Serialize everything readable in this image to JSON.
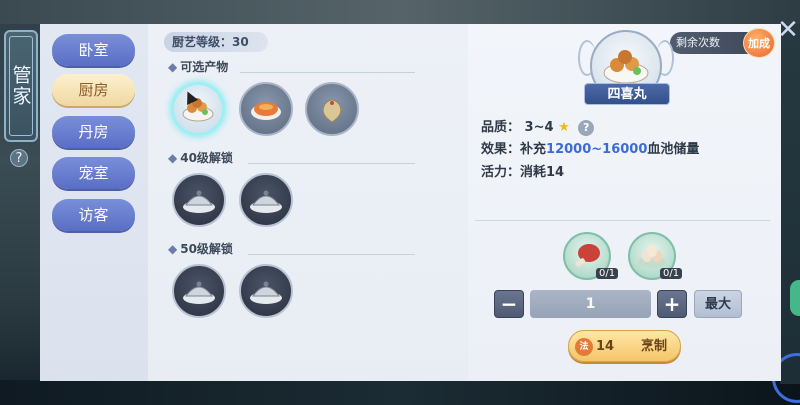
{
  "sidebar": {
    "title": "管家",
    "help": "?"
  },
  "nav": {
    "items": [
      {
        "label": "卧室"
      },
      {
        "label": "厨房"
      },
      {
        "label": "丹房"
      },
      {
        "label": "宠室"
      },
      {
        "label": "访客"
      }
    ]
  },
  "kitchen": {
    "skill_level": "厨艺等级：30",
    "available_title": "可选产物",
    "unlock40_title": "40级解锁",
    "unlock50_title": "50级解锁"
  },
  "counter": {
    "label": "剩余次数",
    "boost": "加成"
  },
  "detail": {
    "dish_name": "四喜丸",
    "quality_label": "品质：",
    "quality_value": "3~4",
    "effect_label": "效果：",
    "effect_prefix": "补充",
    "effect_range": "12000~16000",
    "effect_suffix": "血池储量",
    "vitality_label": "活力：",
    "vitality_value": "消耗14",
    "help": "?"
  },
  "ingredients": [
    {
      "count": "0/1"
    },
    {
      "count": "0/1"
    }
  ],
  "quantity": {
    "minus": "−",
    "value": "1",
    "plus": "+",
    "max": "最大"
  },
  "cook": {
    "cost_icon": "法",
    "cost": "14",
    "label": "烹制"
  },
  "icons": {
    "close": "close-icon",
    "star": "star-icon"
  },
  "colors": {
    "accent": "#3b6bd6",
    "nav": "#5a6fc4",
    "active": "#f0d8a2",
    "cook": "#f4c56a"
  }
}
